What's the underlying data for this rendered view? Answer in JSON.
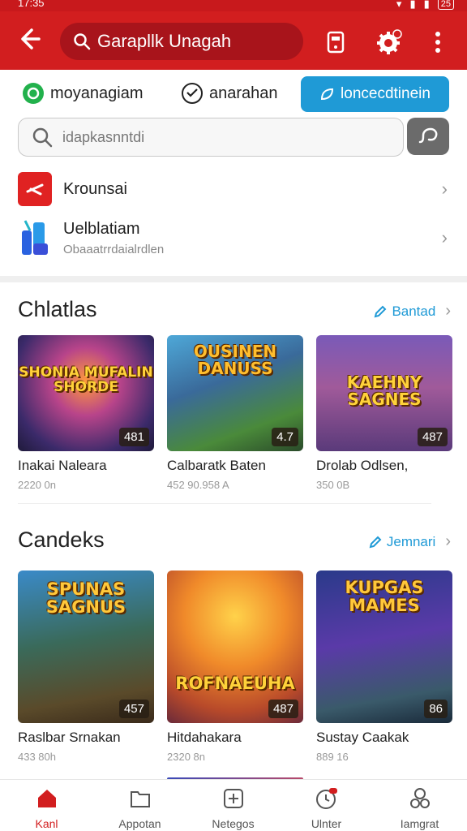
{
  "status_bar": {
    "time": "17:35",
    "battery": "25"
  },
  "app_bar": {
    "search_text": "Garapllk Unagah"
  },
  "filters": {
    "chip1": "moyanagiam",
    "chip2": "anarahan",
    "cta": "loncecdtinein"
  },
  "search": {
    "placeholder": "idapkasnntdi"
  },
  "list": [
    {
      "title": "Krounsai",
      "subtitle": ""
    },
    {
      "title": "Uelblatiam",
      "subtitle": "Obaaatrrdaialrdlen"
    }
  ],
  "sections": [
    {
      "title": "Chlatlas",
      "link": "Bantad",
      "cards": [
        {
          "name": "Inakai Naleara",
          "meta": "2220 0n",
          "badge": "481",
          "logo": "SHONIA MUFALIN SHORDE"
        },
        {
          "name": "Calbaratk Baten",
          "meta": "452 90.958 A",
          "badge": "4.7",
          "logo": "OUSINEN DANUSS"
        },
        {
          "name": "Drolab Odlsen,",
          "meta": "350 0B",
          "badge": "487",
          "logo": "KAEHNY SAGNES"
        }
      ]
    },
    {
      "title": "Candeks",
      "link": "Jemnari",
      "cards": [
        {
          "name": "Raslbar Srnakan",
          "meta": "433 80h",
          "badge": "457",
          "logo": "SPUNAS SAGNUS"
        },
        {
          "name": "Hitdahakara",
          "meta": "2320 8n",
          "badge": "487",
          "logo": "ROFNAEUHA"
        },
        {
          "name": "Sustay Caakak",
          "meta": "889 16",
          "badge": "86",
          "logo": "KUPGAS MAMES"
        }
      ]
    }
  ],
  "bottom_nav": [
    {
      "label": "Kanl",
      "icon": "home-icon"
    },
    {
      "label": "Appotan",
      "icon": "folder-icon"
    },
    {
      "label": "Netegos",
      "icon": "plus-box-icon"
    },
    {
      "label": "Ulnter",
      "icon": "clock-icon"
    },
    {
      "label": "Iamgrat",
      "icon": "people-icon"
    }
  ],
  "colors": {
    "primary_red": "#d21e1f",
    "accent_blue": "#1f9ad6"
  }
}
